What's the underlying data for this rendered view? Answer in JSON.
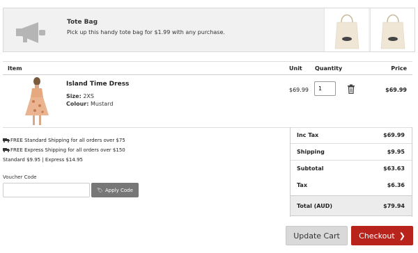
{
  "promo": {
    "title": "Tote Bag",
    "description": "Pick up this handy tote bag for $1.99 with any purchase.",
    "icon": "megaphone-icon",
    "thumbnails": [
      "tote-bag-image",
      "tote-bag-image"
    ]
  },
  "table": {
    "headers": {
      "item": "Item",
      "unit": "Unit",
      "quantity": "Quantity",
      "price": "Price"
    }
  },
  "cart_item": {
    "name": "Island Time Dress",
    "size_label": "Size:",
    "size_value": "2XS",
    "colour_label": "Colour:",
    "colour_value": "Mustard",
    "unit_price": "$69.99",
    "quantity": "1",
    "line_price": "$69.99"
  },
  "shipping": {
    "standard_free": "FREE Standard Shipping for all orders over $75",
    "express_free": "FREE Express Shipping for all orders over $150",
    "rates": "Standard $9.95 | Express $14.95"
  },
  "voucher": {
    "label": "Voucher Code",
    "placeholder": "",
    "button": "Apply Code"
  },
  "totals": {
    "inc_tax_label": "Inc Tax",
    "inc_tax": "$69.99",
    "shipping_label": "Shipping",
    "shipping": "$9.95",
    "subtotal_label": "Subtotal",
    "subtotal": "$63.63",
    "tax_label": "Tax",
    "tax": "$6.36",
    "total_label": "Total (AUD)",
    "total": "$79.94"
  },
  "actions": {
    "update_cart": "Update Cart",
    "checkout": "Checkout"
  },
  "colors": {
    "checkout": "#b8231c",
    "apply_button": "#777777",
    "promo_bg": "#f1f1f1"
  }
}
